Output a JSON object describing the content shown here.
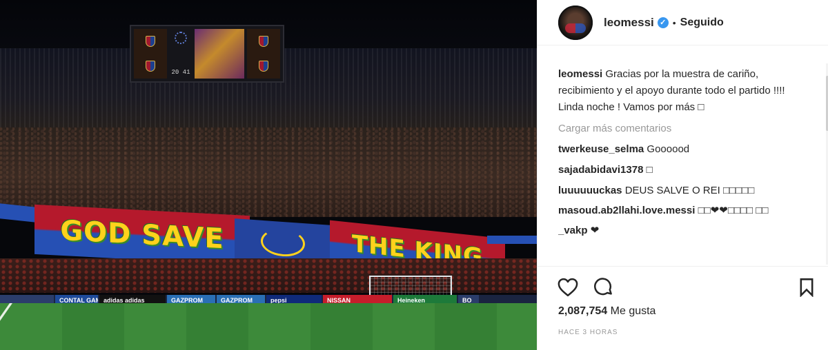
{
  "post": {
    "username": "leomessi",
    "follow_state": "Seguido",
    "separator": "•",
    "verified_glyph": "✓"
  },
  "photo": {
    "scoreboard_time": "20 41",
    "banner_left_text": "GOD SAVE",
    "banner_right_text": "THE KING",
    "ad_boards": [
      {
        "text": "",
        "color": "#2b3d6b"
      },
      {
        "text": "CONTAL GAME",
        "color": "#1e4a9a"
      },
      {
        "text": "adidas adidas",
        "color": "#111111"
      },
      {
        "text": "GAZPROM",
        "color": "#2a6fb5"
      },
      {
        "text": "GAZPROM",
        "color": "#2a6fb5"
      },
      {
        "text": "pepsi",
        "color": "#0f2a7a"
      },
      {
        "text": "NISSAN",
        "color": "#c61d2b"
      },
      {
        "text": "Heineken",
        "color": "#1d7a3a"
      },
      {
        "text": "BO",
        "color": "#2b3d6b"
      }
    ]
  },
  "caption": {
    "user": "leomessi",
    "text": "Gracias por la muestra de cariño, recibimiento y el apoyo durante todo el partido !!!! Linda noche ! Vamos por más □"
  },
  "load_more_label": "Cargar más comentarios",
  "comments": [
    {
      "user": "twerkeuse_selma",
      "text": "Goooood"
    },
    {
      "user": "sajadabidavi1378",
      "text": "□"
    },
    {
      "user": "luuuuuuckas",
      "text": "DEUS SALVE O REI □□□□□"
    },
    {
      "user": "masoud.ab2llahi.love.messi",
      "text": "□□❤❤□□□□ □□"
    },
    {
      "user": "_vakp",
      "text": "❤"
    }
  ],
  "actions": {
    "likes_count": "2,087,754",
    "likes_label": "Me gusta",
    "timestamp": "HACE 3 HORAS",
    "like_icon": "heart-outline-icon",
    "comment_icon": "comment-bubble-icon",
    "save_icon": "bookmark-icon"
  },
  "colors": {
    "text": "#262626",
    "muted": "#999999",
    "verified": "#3897f0",
    "border": "#efefef"
  }
}
